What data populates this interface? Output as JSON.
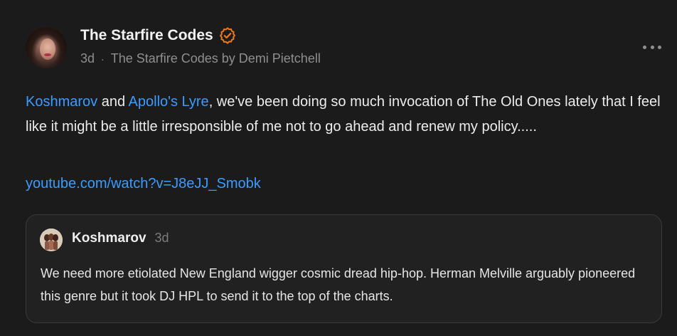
{
  "post": {
    "author_name": "The Starfire Codes",
    "verified_icon": "verified-badge-icon",
    "timestamp": "3d",
    "separator": "·",
    "source": "The Starfire Codes by Demi Pietchell",
    "more_icon": "more-options-icon",
    "mention_1": "Koshmarov",
    "connector_and": " and ",
    "mention_2": "Apollo's Lyre",
    "body_rest": ", we've been doing so much invocation of The Old Ones lately that I feel like it might be a little irresponsible of me not to go ahead and renew my policy.....",
    "link_url": "youtube.com/watch?v=J8eJJ_Smobk"
  },
  "quote": {
    "author_name": "Koshmarov",
    "timestamp": "3d",
    "text": "We need more etiolated New England wigger cosmic dread hip-hop. Herman Melville arguably pioneered this genre but it took DJ HPL to send it to the top of the charts."
  },
  "colors": {
    "background": "#1b1b1b",
    "link": "#3b9cff",
    "verified": "#f07a1a",
    "muted": "#8f8f8f"
  }
}
